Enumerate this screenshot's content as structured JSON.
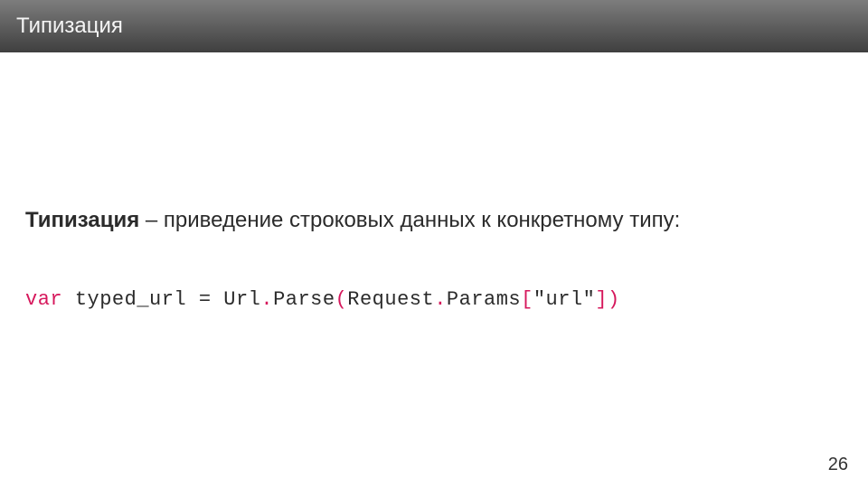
{
  "header": {
    "title": "Типизация"
  },
  "definition": {
    "term": "Типизация",
    "separator": " – ",
    "desc": "приведение строковых данных к конкретному типу:"
  },
  "code": {
    "keyword": "var",
    "space1": " ",
    "ident": "typed_url",
    "space2": " ",
    "eq": "=",
    "space3": " ",
    "type1": "Url",
    "dot1": ".",
    "member1": "Parse",
    "lparen": "(",
    "type2": "Request",
    "dot2": ".",
    "member2": "Params",
    "lbracket": "[",
    "string": "\"url\"",
    "rbracket": "]",
    "rparen": ")"
  },
  "page_number": "26"
}
